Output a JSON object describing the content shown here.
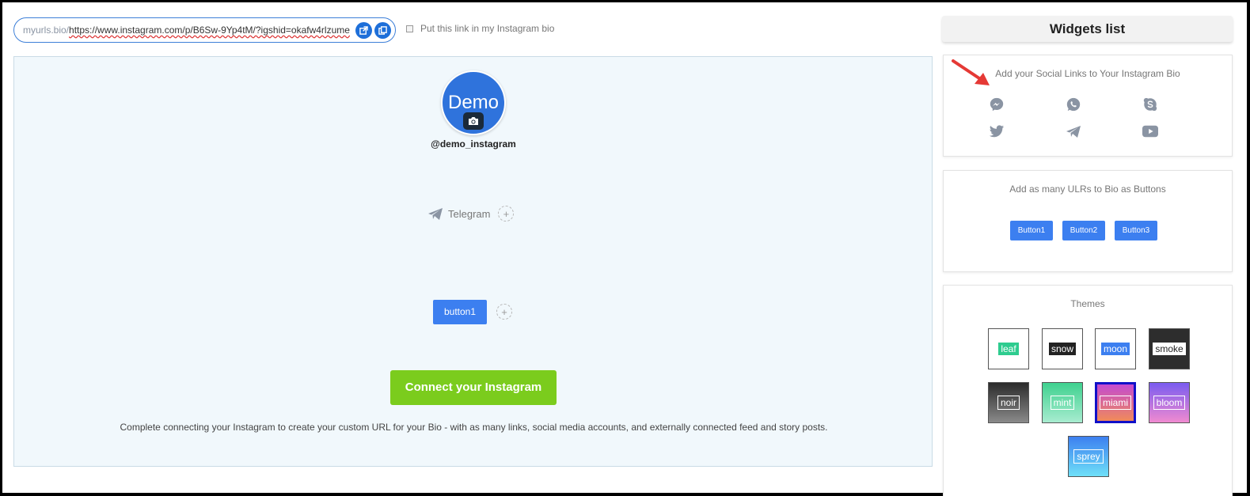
{
  "url_bar": {
    "prefix": "myurls.bio/",
    "value": "https://www.instagram.com/p/B6Sw-9Yp4tM/?igshid=okafw4rlzume"
  },
  "bio_checkbox": {
    "label": "Put this link in my Instagram bio"
  },
  "preview": {
    "avatar_text": "Demo",
    "handle": "@demo_instagram",
    "social_item": {
      "icon": "telegram-icon",
      "label": "Telegram"
    },
    "button_label": "button1",
    "connect_label": "Connect your Instagram",
    "hint": "Complete connecting your Instagram to create your custom URL for your Bio - with as many links, social media accounts, and externally connected feed and story posts."
  },
  "widgets": {
    "title": "Widgets list",
    "social": {
      "title": "Add your Social Links to Your Instagram Bio",
      "icons": [
        "messenger-icon",
        "whatsapp-icon",
        "skype-icon",
        "twitter-icon",
        "telegram-icon",
        "youtube-icon"
      ]
    },
    "buttons": {
      "title": "Add as many ULRs to Bio as Buttons",
      "items": [
        "Button1",
        "Button2",
        "Button3"
      ]
    },
    "themes": {
      "title": "Themes",
      "items": [
        {
          "label": "leaf",
          "label_bg": "#2ecc8f",
          "label_color": "#ffffff",
          "bg": "#ffffff"
        },
        {
          "label": "snow",
          "label_bg": "#222222",
          "label_color": "#ffffff",
          "bg": "#ffffff"
        },
        {
          "label": "moon",
          "label_bg": "#3c7ff0",
          "label_color": "#ffffff",
          "bg": "#ffffff"
        },
        {
          "label": "smoke",
          "label_bg": "#ffffff",
          "label_color": "#222222",
          "bg": "#2d2d2d"
        },
        {
          "label": "noir",
          "label_bg": "transparent",
          "label_color": "#ffffff",
          "bg": "linear-gradient(#2b2b2b,#8a8a8a)"
        },
        {
          "label": "mint",
          "label_bg": "transparent",
          "label_color": "#ffffff",
          "bg": "linear-gradient(#3fd18f,#a8ecd0)"
        },
        {
          "label": "miami",
          "label_bg": "transparent",
          "label_color": "#ffffff",
          "bg": "linear-gradient(#c44bd0,#f08a5a)",
          "selected": true
        },
        {
          "label": "bloom",
          "label_bg": "transparent",
          "label_color": "#ffffff",
          "bg": "linear-gradient(#7a5cf0,#f08ad0)"
        },
        {
          "label": "sprey",
          "label_bg": "transparent",
          "label_color": "#ffffff",
          "bg": "linear-gradient(#3c7ff0,#6fe0f8)"
        }
      ]
    }
  },
  "colors": {
    "accent_blue": "#3c7ff0",
    "connect_green": "#7bcc1d",
    "preview_bg": "#f1f8fc",
    "annotation_arrow": "#e53935"
  }
}
